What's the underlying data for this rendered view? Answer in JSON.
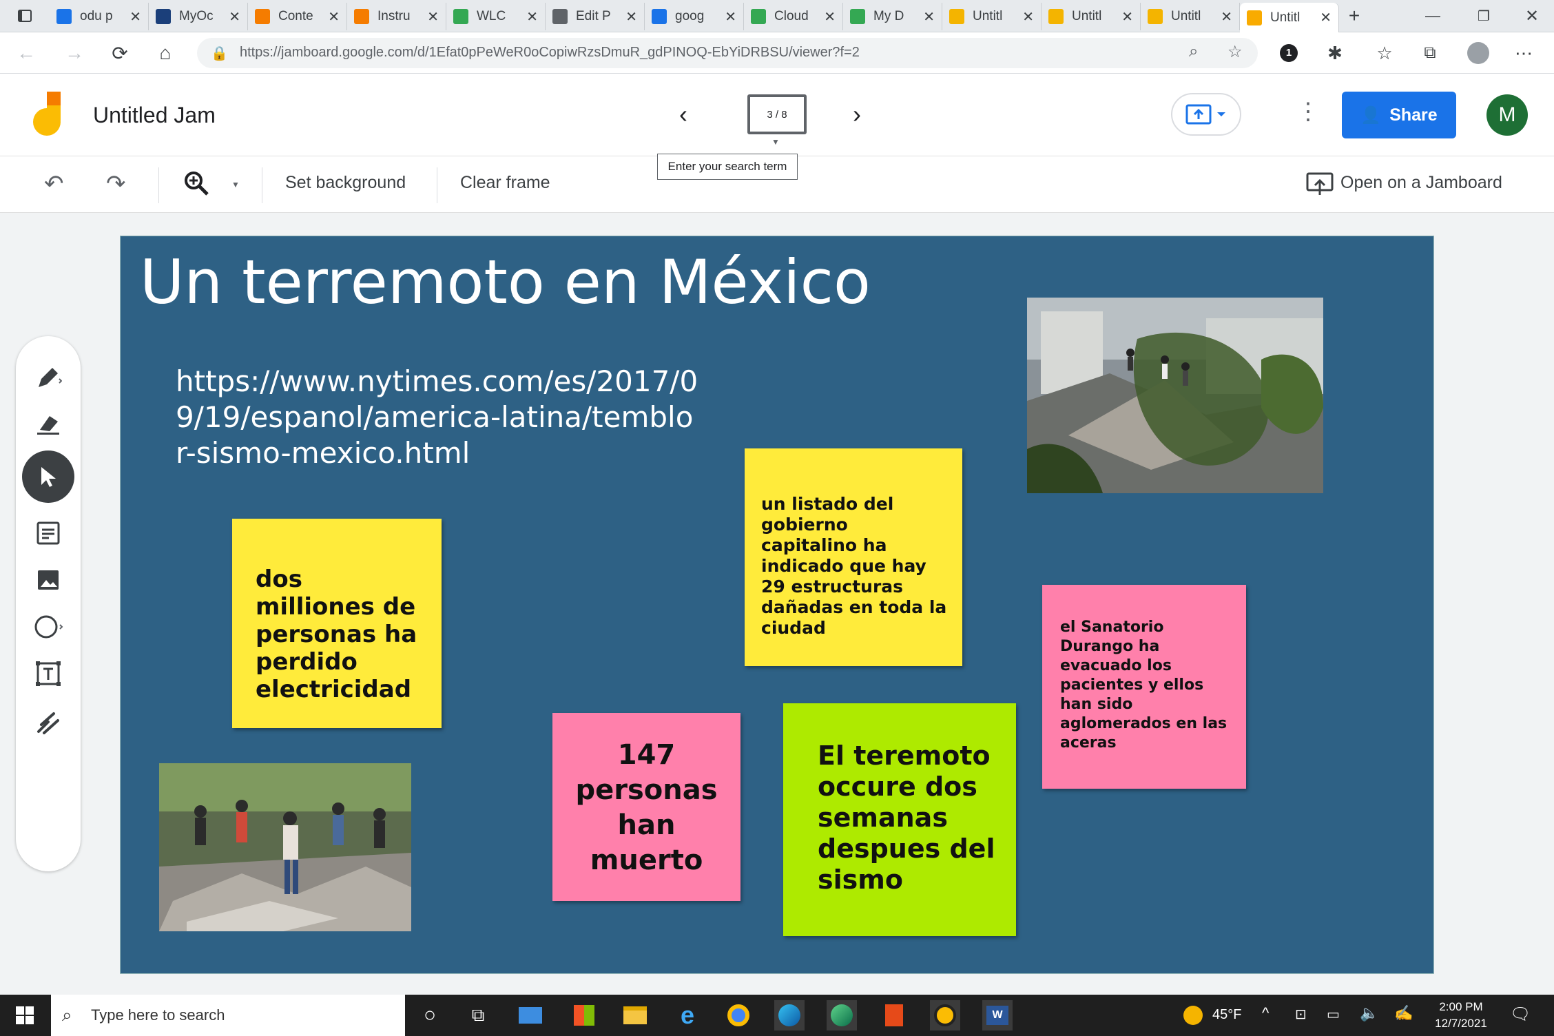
{
  "browser": {
    "tabs": [
      {
        "label": "odu p",
        "icon": "bing-icon"
      },
      {
        "label": "MyOc",
        "icon": "odu-icon"
      },
      {
        "label": "Conte",
        "icon": "pencil-doc-icon"
      },
      {
        "label": "Instru",
        "icon": "pencil-doc-icon"
      },
      {
        "label": "WLC",
        "icon": "drive-icon"
      },
      {
        "label": "Edit P",
        "icon": "page-icon"
      },
      {
        "label": "goog",
        "icon": "bing-icon"
      },
      {
        "label": "Cloud",
        "icon": "drive-icon"
      },
      {
        "label": "My D",
        "icon": "drive-icon"
      },
      {
        "label": "Untitl",
        "icon": "slides-icon"
      },
      {
        "label": "Untitl",
        "icon": "slides-icon"
      },
      {
        "label": "Untitl",
        "icon": "slides-icon"
      },
      {
        "label": "Untitl",
        "icon": "jamboard-icon"
      }
    ],
    "url": "https://jamboard.google.com/d/1Efat0pPeWeR0oCopiwRzsDmuR_gdPINOQ-EbYiDRBSU/viewer?f=2",
    "extension_badge": "1"
  },
  "app": {
    "title": "Untitled Jam",
    "frame_counter": "3 / 8",
    "tooltip": "Enter your search term",
    "share_label": "Share",
    "avatar_letter": "M",
    "toolbar": {
      "set_background": "Set background",
      "clear_frame": "Clear frame",
      "open_on_jamboard": "Open on a Jamboard"
    }
  },
  "canvas": {
    "background_color": "#2e6185",
    "title": "Un terremoto en México",
    "url_text": "https://www.nytimes.com/es/2017/09/19/espanol/america-latina/temblor-sismo-mexico.html",
    "stickies": [
      {
        "text": "dos milliones de personas ha perdido electricidad",
        "color": "#ffeb3b"
      },
      {
        "text": "un listado del gobierno capitalino ha indicado que hay 29 estructuras dañadas en toda la ciudad",
        "color": "#ffeb3b"
      },
      {
        "text": "el Sanatorio Durango ha evacuado los pacientes y ellos han sido aglomerados en las aceras",
        "color": "#ff80ab"
      },
      {
        "text": "147 personas han muerto",
        "color": "#ff80ab"
      },
      {
        "text": "El teremoto occure dos semanas despues del sismo",
        "color": "#aeea00"
      }
    ]
  },
  "taskbar": {
    "search_placeholder": "Type here to search",
    "weather": "45°F",
    "time": "2:00 PM",
    "date": "12/7/2021"
  }
}
